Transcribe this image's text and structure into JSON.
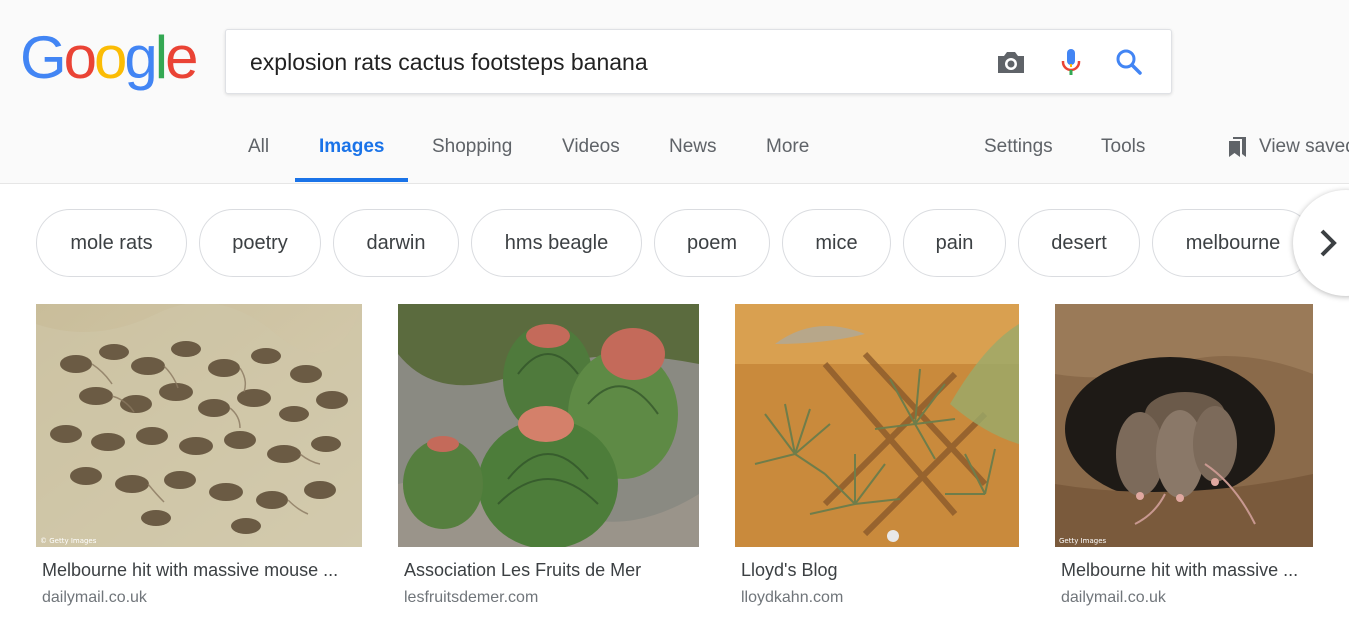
{
  "logo": {
    "letters": [
      "G",
      "o",
      "o",
      "g",
      "l",
      "e"
    ],
    "colors": [
      "#4285F4",
      "#EA4335",
      "#FBBC05",
      "#4285F4",
      "#34A853",
      "#EA4335"
    ]
  },
  "search": {
    "query": "explosion rats cactus footsteps banana",
    "icons": [
      "camera-icon",
      "microphone-icon",
      "search-icon"
    ]
  },
  "nav": {
    "tabs": [
      "All",
      "Images",
      "Shopping",
      "Videos",
      "News",
      "More"
    ],
    "active_tab": "Images",
    "settings": "Settings",
    "tools": "Tools",
    "view_saved": "View saved",
    "accent": "#1a73e8"
  },
  "chips": [
    "mole rats",
    "poetry",
    "darwin",
    "hms beagle",
    "poem",
    "mice",
    "pain",
    "desert",
    "melbourne"
  ],
  "results": [
    {
      "title": "Melbourne hit with massive mouse ...",
      "domain": "dailymail.co.uk",
      "watermark": "© Getty Images",
      "image": "mouse-plague-photo"
    },
    {
      "title": "Association Les Fruits de Mer",
      "domain": "lesfruitsdemer.com",
      "image": "barrel-cactus-photo"
    },
    {
      "title": "Lloyd's Blog",
      "domain": "lloydkahn.com",
      "image": "air-plants-photo"
    },
    {
      "title": "Melbourne hit with massive ...",
      "domain": "dailymail.co.uk",
      "watermark": "Getty Images",
      "image": "mice-in-burrow-photo"
    }
  ]
}
